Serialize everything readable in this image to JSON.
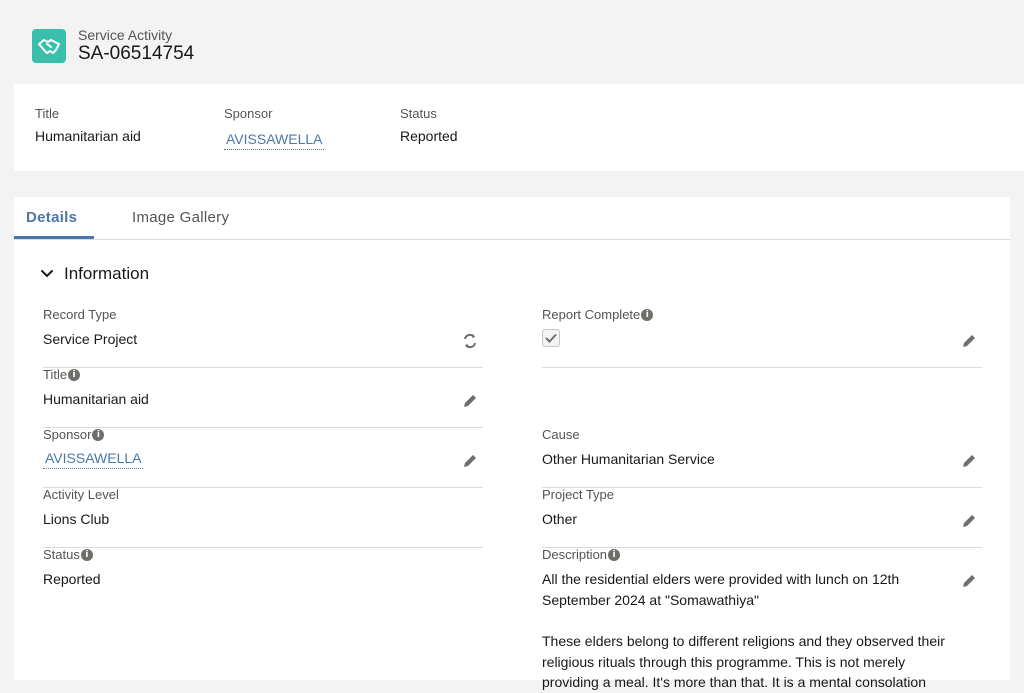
{
  "header": {
    "object_type": "Service Activity",
    "record_name": "SA-06514754",
    "icon": "handshake-icon"
  },
  "highlights": {
    "title_label": "Title",
    "title_value": "Humanitarian aid",
    "sponsor_label": "Sponsor",
    "sponsor_value": "AVISSAWELLA",
    "status_label": "Status",
    "status_value": "Reported"
  },
  "tabs": [
    {
      "label": "Details",
      "active": true
    },
    {
      "label": "Image Gallery",
      "active": false
    }
  ],
  "section": {
    "title": "Information"
  },
  "fields": {
    "record_type": {
      "label": "Record Type",
      "value": "Service Project"
    },
    "report_complete": {
      "label": "Report Complete",
      "checked": true
    },
    "title": {
      "label": "Title",
      "value": "Humanitarian aid"
    },
    "sponsor": {
      "label": "Sponsor",
      "value": "AVISSAWELLA"
    },
    "cause": {
      "label": "Cause",
      "value": "Other Humanitarian Service"
    },
    "activity_level": {
      "label": "Activity Level",
      "value": "Lions Club"
    },
    "project_type": {
      "label": "Project Type",
      "value": "Other"
    },
    "status": {
      "label": "Status",
      "value": "Reported"
    },
    "description": {
      "label": "Description",
      "paragraphs": [
        "All the residential elders were provided with lunch on 12th September 2024 at \"Somawathiya\"",
        "These elders belong to different religions and they observed their religious rituals through this programme. This is not merely providing a meal. It's more than that. It is a mental consolation"
      ]
    }
  },
  "colors": {
    "accent": "#4a78a8",
    "icon_bg": "#3bbfad"
  }
}
